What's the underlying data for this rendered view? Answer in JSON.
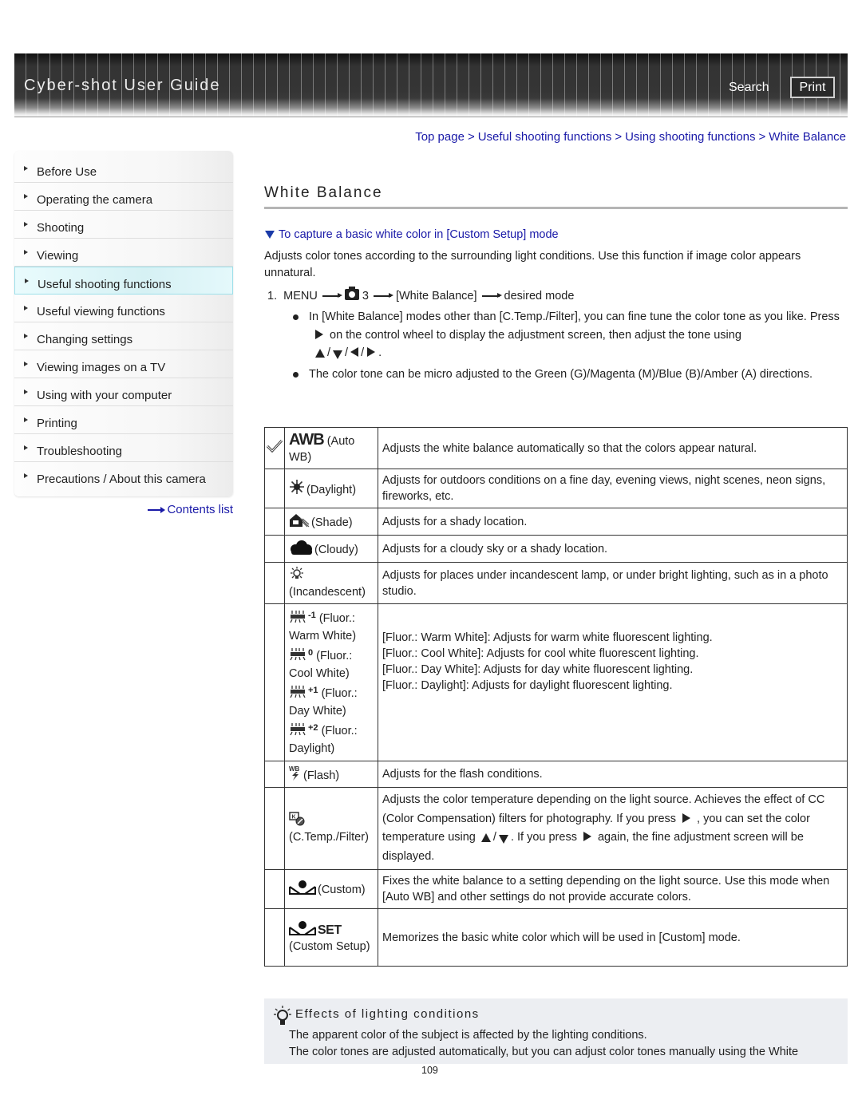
{
  "header": {
    "app_title": "Cyber-shot User Guide",
    "search_label": "Search",
    "print_label": "Print"
  },
  "breadcrumb": [
    {
      "label": "Top page"
    },
    {
      "label": "Useful shooting functions"
    },
    {
      "label": "Using shooting functions"
    },
    {
      "label": "White Balance"
    }
  ],
  "breadcrumb_separator": ">",
  "sidebar": {
    "items": [
      {
        "label": "Before Use",
        "active": false
      },
      {
        "label": "Operating the camera",
        "active": false
      },
      {
        "label": "Shooting",
        "active": false
      },
      {
        "label": "Viewing",
        "active": false
      },
      {
        "label": "Useful shooting functions",
        "active": true
      },
      {
        "label": "Useful viewing functions",
        "active": false
      },
      {
        "label": "Changing settings",
        "active": false
      },
      {
        "label": "Viewing images on a TV",
        "active": false
      },
      {
        "label": "Using with your computer",
        "active": false
      },
      {
        "label": "Printing",
        "active": false
      },
      {
        "label": "Troubleshooting",
        "active": false
      },
      {
        "label": "Precautions / About this camera",
        "active": false
      }
    ],
    "contents_link": "Contents list"
  },
  "main": {
    "title": "White Balance",
    "anchor_link": "To capture a basic white color in [Custom Setup] mode",
    "intro": "Adjusts color tones according to the surrounding light conditions. Use this function if image color appears unnatural.",
    "step": {
      "number": "1.",
      "menu": "MENU",
      "tab": "3",
      "item": "[White Balance]",
      "target": "desired mode"
    },
    "bullets": {
      "b1_part1": "In [White Balance] modes other than [C.Temp./Filter], you can fine tune the color tone as you like. Press",
      "b1_part2": "on the control wheel to display the adjustment screen, then adjust the tone using",
      "slash": "/",
      "period": ".",
      "b2": "The color tone can be micro adjusted to the Green (G)/Magenta (M)/Blue (B)/Amber (A) directions."
    },
    "modes": [
      {
        "icon": "AWB",
        "name": "(Auto WB)",
        "desc": "Adjusts the white balance automatically so that the colors appear natural.",
        "default": true
      },
      {
        "icon": "daylight-icon",
        "name": "(Daylight)",
        "desc": "Adjusts for outdoors conditions on a fine day, evening views, night scenes, neon signs, fireworks, etc."
      },
      {
        "icon": "shade-icon",
        "name": "(Shade)",
        "desc": "Adjusts for a shady location."
      },
      {
        "icon": "cloudy-icon",
        "name": "(Cloudy)",
        "desc": "Adjusts for a cloudy sky or a shady location."
      },
      {
        "icon": "incandescent-icon",
        "name": "(Incandescent)",
        "desc": "Adjusts for places under incandescent lamp, or under bright lighting, such as in a photo studio."
      },
      {
        "fluor": [
          {
            "sup": "-1",
            "name": "(Fluor.: Warm White)"
          },
          {
            "sup": "0",
            "name": "(Fluor.: Cool White)"
          },
          {
            "sup": "+1",
            "name": "(Fluor.: Day White)"
          },
          {
            "sup": "+2",
            "name": "(Fluor.: Daylight)"
          }
        ],
        "desc_lines": [
          "[Fluor.: Warm White]: Adjusts for warm white fluorescent lighting.",
          "[Fluor.: Cool White]: Adjusts for cool white fluorescent lighting.",
          "[Fluor.: Day White]: Adjusts for day white fluorescent lighting.",
          "[Fluor.: Daylight]: Adjusts for daylight fluorescent lighting."
        ]
      },
      {
        "icon": "flash-wb-icon",
        "name": "(Flash)",
        "desc": "Adjusts for the flash conditions."
      },
      {
        "icon": "ctemp-filter-icon",
        "name": "(C.Temp./Filter)",
        "desc_p1": "Adjusts the color temperature depending on the light source. Achieves the effect of CC (Color Compensation) filters for photography. If you press",
        "desc_p2": ", you can set the color temperature using",
        "desc_p3": ". If you press",
        "desc_p4": "again, the fine adjustment screen will be displayed."
      },
      {
        "icon": "custom-icon",
        "name": "(Custom)",
        "desc": "Fixes the white balance to a setting depending on the light source. Use this mode when [Auto WB] and other settings do not provide accurate colors."
      },
      {
        "icon": "custom-set-icon",
        "icon_text": "SET",
        "name": "(Custom Setup)",
        "desc": "Memorizes the basic white color which will be used in [Custom] mode."
      }
    ]
  },
  "hint": {
    "title": "Effects of lighting conditions",
    "line1": "The apparent color of the subject is affected by the lighting conditions.",
    "line2": "The color tones are adjusted automatically, but you can adjust color tones manually using the White"
  },
  "page_number": "109"
}
